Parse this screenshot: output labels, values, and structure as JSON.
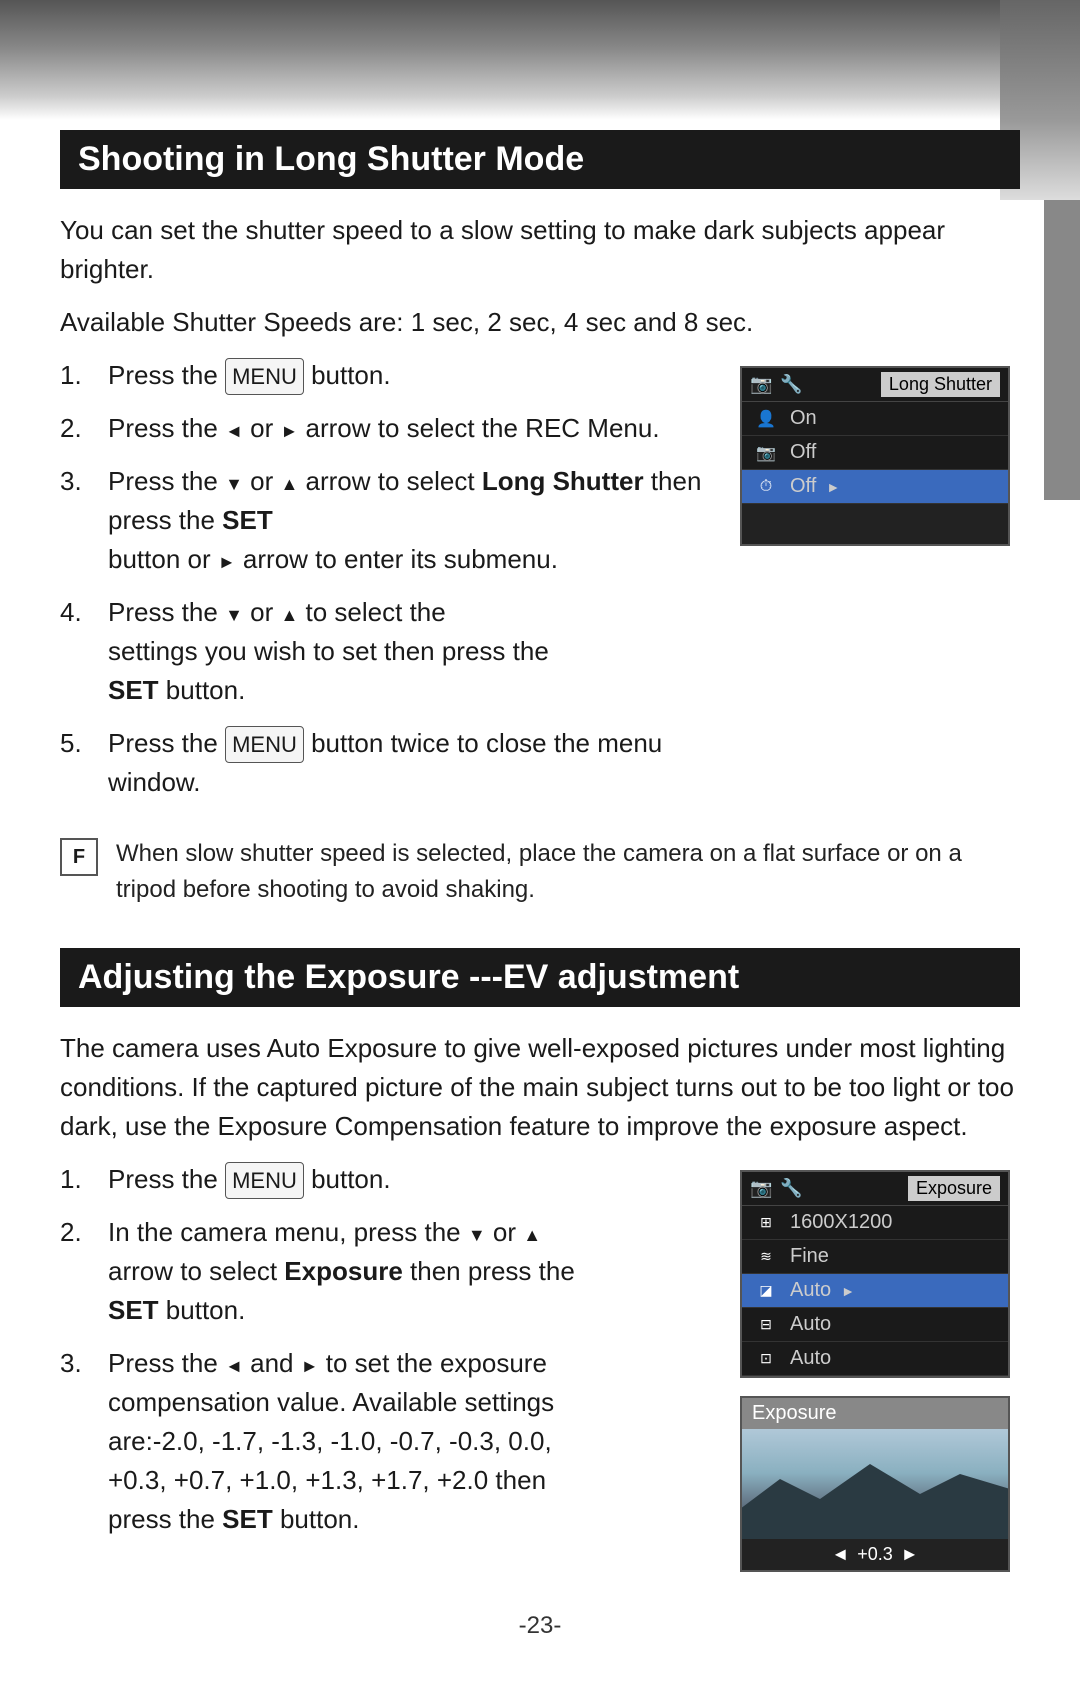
{
  "page": {
    "bg_color": "#ffffff",
    "page_number": "-23-"
  },
  "section1": {
    "title": "Shooting in Long Shutter Mode",
    "intro1": "You can set the shutter speed to a slow setting to make dark subjects appear brighter.",
    "intro2": "Available Shutter Speeds are: 1 sec, 2 sec, 4 sec and 8 sec.",
    "steps": [
      {
        "num": "1.",
        "text": "Press the  button."
      },
      {
        "num": "2.",
        "text": "Press the ◄ or ► arrow to select the REC Menu."
      },
      {
        "num": "3.",
        "text": "Press the ▼ or ▲ arrow to select Long Shutter then press the SET button or ► arrow to enter its submenu."
      },
      {
        "num": "4.",
        "text": "Press the ▼ or ▲ to select the settings you wish to set then press the SET button."
      },
      {
        "num": "5.",
        "text": "Press the  button twice to close the menu window."
      }
    ],
    "note": "When slow shutter speed is selected, place the camera on a flat surface or on a tripod before shooting to avoid shaking.",
    "menu": {
      "header_icons": "📷 🔧",
      "header_title": "Long Shutter",
      "rows": [
        {
          "icon": "👤",
          "label": "",
          "value": "On",
          "selected": false
        },
        {
          "icon": "📷",
          "label": "",
          "value": "Off",
          "selected": false
        },
        {
          "icon": "⏱",
          "label": "",
          "value": "Off",
          "selected": true,
          "has_arrow": true
        }
      ]
    }
  },
  "section2": {
    "title": "Adjusting the Exposure ---EV adjustment",
    "intro": "The camera uses Auto Exposure to give well-exposed pictures under most lighting conditions. If the captured picture of the main subject turns out to be too light or too dark, use the Exposure Compensation feature to improve the exposure aspect.",
    "steps": [
      {
        "num": "1.",
        "text": "Press the  button."
      },
      {
        "num": "2.",
        "text": "In the camera menu, press the ▼ or ▲ arrow to select Exposure then press the SET button."
      },
      {
        "num": "3.",
        "text": "Press the ◄ and ► to set the exposure compensation value. Available settings are:-2.0, -1.7, -1.3, -1.0, -0.7, -0.3, 0.0, +0.3, +0.7, +1.0, +1.3, +1.7, +2.0 then press the SET button."
      }
    ],
    "menu": {
      "header_title": "Exposure",
      "rows": [
        {
          "icon": "⊞",
          "label": "",
          "value": "1600X1200",
          "selected": false
        },
        {
          "icon": "≋",
          "label": "",
          "value": "Fine",
          "selected": false
        },
        {
          "icon": "◪",
          "label": "",
          "value": "Auto",
          "selected": true,
          "has_arrow": true
        },
        {
          "icon": "⊟",
          "label": "",
          "value": "Auto",
          "selected": false
        },
        {
          "icon": "⊡",
          "label": "",
          "value": "Auto",
          "selected": false
        }
      ]
    },
    "preview": {
      "title": "Exposure",
      "value": "◄ +0.3 ►"
    }
  }
}
